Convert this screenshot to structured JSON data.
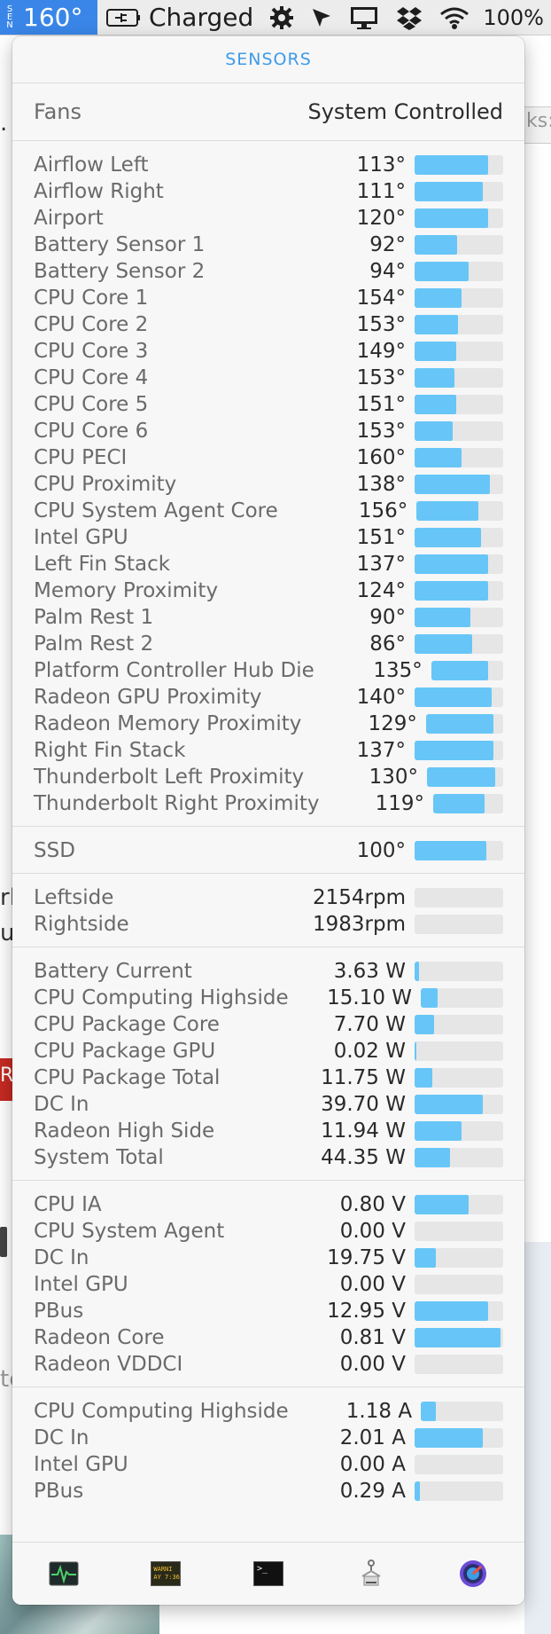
{
  "menubar": {
    "app_badge": [
      "S",
      "E",
      "N"
    ],
    "temp_display": "160°",
    "battery_label": "Charged",
    "battery_percent": "100%",
    "icons": [
      "battery-plug-icon",
      "gear-icon",
      "cursor-icon",
      "display-icon",
      "dropbox-icon",
      "wifi-icon"
    ]
  },
  "background": {
    "fragments": [
      ".",
      "ks:",
      "rl",
      "ul",
      "Re",
      "te"
    ]
  },
  "panel": {
    "title": "SENSORS",
    "fans": {
      "label": "Fans",
      "value": "System Controlled"
    },
    "temperatures": [
      {
        "label": "Airflow Left",
        "value": "113°",
        "level": 0.83
      },
      {
        "label": "Airflow Right",
        "value": "111°",
        "level": 0.77
      },
      {
        "label": "Airport",
        "value": "120°",
        "level": 0.83
      },
      {
        "label": "Battery Sensor 1",
        "value": "92°",
        "level": 0.48
      },
      {
        "label": "Battery Sensor 2",
        "value": "94°",
        "level": 0.61
      },
      {
        "label": "CPU Core 1",
        "value": "154°",
        "level": 0.53
      },
      {
        "label": "CPU Core 2",
        "value": "153°",
        "level": 0.49
      },
      {
        "label": "CPU Core 3",
        "value": "149°",
        "level": 0.47
      },
      {
        "label": "CPU Core 4",
        "value": "153°",
        "level": 0.45
      },
      {
        "label": "CPU Core 5",
        "value": "151°",
        "level": 0.47
      },
      {
        "label": "CPU Core 6",
        "value": "153°",
        "level": 0.43
      },
      {
        "label": "CPU PECI",
        "value": "160°",
        "level": 0.53
      },
      {
        "label": "CPU Proximity",
        "value": "138°",
        "level": 0.85
      },
      {
        "label": "CPU System Agent Core",
        "value": "156°",
        "level": 0.71
      },
      {
        "label": "Intel GPU",
        "value": "151°",
        "level": 0.75
      },
      {
        "label": "Left Fin Stack",
        "value": "137°",
        "level": 0.83
      },
      {
        "label": "Memory Proximity",
        "value": "124°",
        "level": 0.83
      },
      {
        "label": "Palm Rest 1",
        "value": "90°",
        "level": 0.63
      },
      {
        "label": "Palm Rest 2",
        "value": "86°",
        "level": 0.65
      },
      {
        "label": "Platform Controller Hub Die",
        "value": "135°",
        "level": 0.79
      },
      {
        "label": "Radeon GPU Proximity",
        "value": "140°",
        "level": 0.87
      },
      {
        "label": "Radeon Memory Proximity",
        "value": "129°",
        "level": 0.87
      },
      {
        "label": "Right Fin Stack",
        "value": "137°",
        "level": 0.89
      },
      {
        "label": "Thunderbolt Left Proximity",
        "value": "130°",
        "level": 0.89
      },
      {
        "label": "Thunderbolt Right Proximity",
        "value": "119°",
        "level": 0.73
      }
    ],
    "disks": [
      {
        "label": "SSD",
        "value": "100°",
        "level": 0.81
      }
    ],
    "fan_speeds": [
      {
        "label": "Leftside",
        "value": "2154rpm",
        "level": 0
      },
      {
        "label": "Rightside",
        "value": "1983rpm",
        "level": 0
      }
    ],
    "power": [
      {
        "label": "Battery Current",
        "value": "3.63 W",
        "level": 0.05
      },
      {
        "label": "CPU Computing Highside",
        "value": "15.10 W",
        "level": 0.2
      },
      {
        "label": "CPU Package Core",
        "value": "7.70 W",
        "level": 0.22
      },
      {
        "label": "CPU Package GPU",
        "value": "0.02 W",
        "level": 0.02
      },
      {
        "label": "CPU Package Total",
        "value": "11.75 W",
        "level": 0.2
      },
      {
        "label": "DC In",
        "value": "39.70 W",
        "level": 0.77
      },
      {
        "label": "Radeon High Side",
        "value": "11.94 W",
        "level": 0.53
      },
      {
        "label": "System Total",
        "value": "44.35 W",
        "level": 0.4
      }
    ],
    "voltage": [
      {
        "label": "CPU IA",
        "value": "0.80 V",
        "level": 0.61
      },
      {
        "label": "CPU System Agent",
        "value": "0.00 V",
        "level": 0
      },
      {
        "label": "DC In",
        "value": "19.75 V",
        "level": 0.24
      },
      {
        "label": "Intel GPU",
        "value": "0.00 V",
        "level": 0
      },
      {
        "label": "PBus",
        "value": "12.95 V",
        "level": 0.83
      },
      {
        "label": "Radeon Core",
        "value": "0.81 V",
        "level": 0.97
      },
      {
        "label": "Radeon VDDCI",
        "value": "0.00 V",
        "level": 0
      }
    ],
    "current": [
      {
        "label": "CPU Computing Highside",
        "value": "1.18 A",
        "level": 0.18
      },
      {
        "label": "DC In",
        "value": "2.01 A",
        "level": 0.77
      },
      {
        "label": "Intel GPU",
        "value": "0.00 A",
        "level": 0
      },
      {
        "label": "PBus",
        "value": "0.29 A",
        "level": 0.06
      }
    ],
    "toolbar": {
      "console_text": "WARNI\nAY 7:36",
      "terminal_prompt": ">_",
      "items": [
        "activity-monitor-icon",
        "console-icon",
        "terminal-icon",
        "system-information-icon",
        "disk-utility-icon"
      ]
    },
    "colors": {
      "accent": "#3d9be9",
      "bar_fill": "#67c6f7",
      "bar_track": "#e6e6e6",
      "menubar_active": "#3a86e8"
    }
  }
}
